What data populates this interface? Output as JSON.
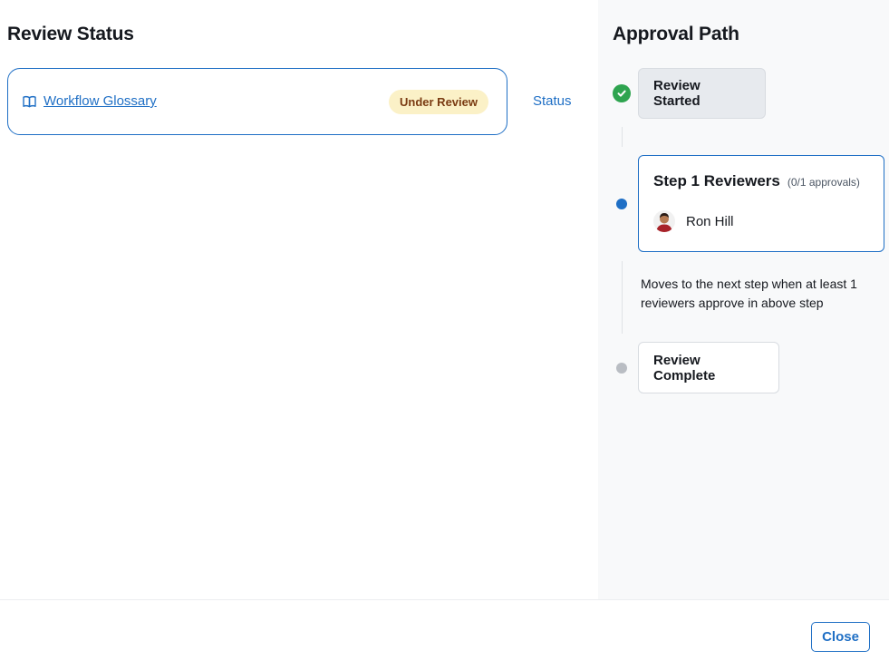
{
  "review_status": {
    "title": "Review Status",
    "asset": {
      "name": "Workflow Glossary",
      "icon": "book-icon",
      "badge": "Under Review",
      "badge_bg": "#fbf1c7",
      "badge_color": "#7a3b12"
    },
    "status_link": "Status"
  },
  "approval_path": {
    "title": "Approval Path",
    "steps": [
      {
        "label": "Review Started",
        "state": "done",
        "icon": "check-circle-icon",
        "color": "#2ea44f"
      },
      {
        "label": "Step 1 Reviewers",
        "count": "(0/1 approvals)",
        "state": "current",
        "color": "#1f6fc5",
        "reviewers": [
          {
            "name": "Ron Hill",
            "icon": "avatar"
          }
        ]
      },
      {
        "label": "Review Complete",
        "state": "pending",
        "color": "#b9bdc3"
      }
    ],
    "rule": "Moves to the next step when at least 1 reviewers approve in above step"
  },
  "footer": {
    "close_label": "Close"
  },
  "colors": {
    "accent": "#1f6fc5",
    "success": "#2ea44f",
    "pending": "#b9bdc3"
  }
}
